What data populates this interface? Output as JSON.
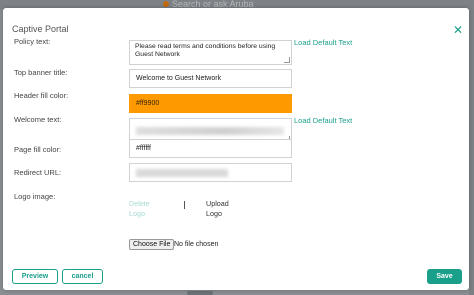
{
  "background": {
    "search_placeholder": "Search or ask Aruba"
  },
  "modal": {
    "title": "Captive Portal",
    "close_icon": "close-x-icon",
    "accent_color": "#1a9f8a"
  },
  "form": {
    "policy_text": {
      "label": "Policy text:",
      "value": "Please read terms and conditions before using Guest Network",
      "link": "Load Default Text"
    },
    "top_banner_title": {
      "label": "Top banner title:",
      "value": "Welcome to Guest Network"
    },
    "header_fill_color": {
      "label": "Header fill color:",
      "value": "#ff9900"
    },
    "welcome_text": {
      "label": "Welcome text:",
      "value": "",
      "link": "Load Default Text"
    },
    "page_fill_color": {
      "label": "Page fill color:",
      "value": "#ffffff"
    },
    "redirect_url": {
      "label": "Redirect URL:",
      "value": ""
    },
    "logo_image": {
      "label": "Logo image:",
      "delete_label": "Delete\nLogo",
      "upload_label": "Upload\nLogo",
      "file_button": "Choose File",
      "file_status": "No file chosen"
    }
  },
  "footer": {
    "preview_label": "Preview",
    "cancel_label": "cancel",
    "save_label": "Save"
  }
}
